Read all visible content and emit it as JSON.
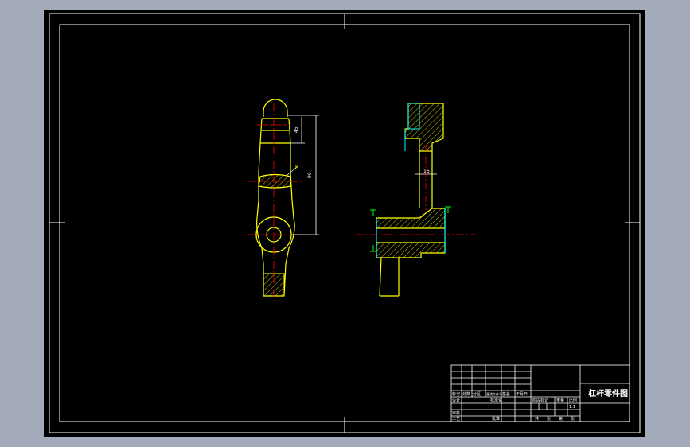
{
  "drawing": {
    "title": "杠杆零件图",
    "colors": {
      "background": "#000000",
      "border": "#ffffff",
      "outline": "#ffff00",
      "hatch": "#ffff00",
      "centerline": "#ff0000",
      "dimension": "#ffffff",
      "section_fill": "#00ffff",
      "marker": "#00ff00"
    }
  },
  "title_block": {
    "part_name": "杠杆零件图",
    "scale": "1:1",
    "row_labels": {
      "mark": "标记",
      "count": "处数",
      "zone": "分区",
      "change_doc": "更改文件号",
      "signature": "签名",
      "date": "年月日",
      "design": "设计",
      "standardize": "标准化",
      "stage_mark": "阶段标记",
      "weight": "重量",
      "scale_label": "比例",
      "review": "审核",
      "process": "工艺",
      "approve": "批准",
      "sheet_total": "共",
      "sheet": "张",
      "sheet_no": "第",
      "page": "张"
    }
  },
  "dimensions": {
    "small_dim": "45",
    "long_dim": "90",
    "web_dim": "16",
    "angle_note": "R"
  }
}
